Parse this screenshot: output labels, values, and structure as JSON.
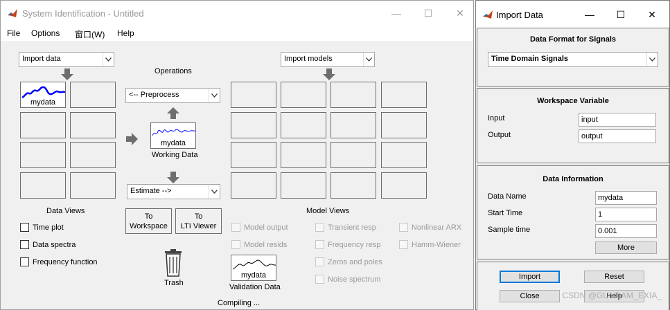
{
  "main_window": {
    "title": "System Identification - Untitled",
    "controls": {
      "minimize": "—",
      "maximize": "☐",
      "close": "✕"
    },
    "menu": [
      "File",
      "Options",
      "窗口(W)",
      "Help"
    ],
    "import_data_dropdown": "Import data",
    "import_models_dropdown": "Import models",
    "operations_label": "Operations",
    "preprocess_dropdown": "<-- Preprocess",
    "estimate_dropdown": "Estimate -->",
    "data_slot_label": "mydata",
    "working_data": {
      "name": "mydata",
      "label": "Working Data"
    },
    "validation_data": {
      "name": "mydata",
      "label": "Validation Data"
    },
    "data_views_label": "Data Views",
    "data_views": [
      "Time plot",
      "Data spectra",
      "Frequency function"
    ],
    "to_workspace": [
      "To",
      "Workspace"
    ],
    "to_lti_viewer": [
      "To",
      "LTI Viewer"
    ],
    "trash_label": "Trash",
    "model_views_label": "Model Views",
    "model_views_col1": [
      "Model output",
      "Model resids"
    ],
    "model_views_col2": [
      "Transient resp",
      "Frequency resp",
      "Zeros and poles",
      "Noise spectrum"
    ],
    "model_views_col3": [
      "Nonlinear ARX",
      "Hamm-Wiener"
    ],
    "status": "Compiling ..."
  },
  "import_window": {
    "title": "Import Data",
    "controls": {
      "minimize": "—",
      "maximize": "☐",
      "close": "✕"
    },
    "format_section": "Data Format for Signals",
    "format_value": "Time Domain Signals",
    "workspace_section": "Workspace Variable",
    "input_label": "Input",
    "input_value": "input",
    "output_label": "Output",
    "output_value": "output",
    "info_section": "Data Information",
    "data_name_label": "Data Name",
    "data_name_value": "mydata",
    "start_time_label": "Start Time",
    "start_time_value": "1",
    "sample_time_label": "Sample time",
    "sample_time_value": "0.001",
    "more": "More",
    "import": "Import",
    "reset": "Reset",
    "close": "Close",
    "help": "Help"
  },
  "watermark": "CSDN @GUNDAM_EXIA_",
  "colors": {
    "signal_primary": "#0000ff",
    "signal_secondary": "#000000",
    "window_bg": "#f0f0f0"
  }
}
